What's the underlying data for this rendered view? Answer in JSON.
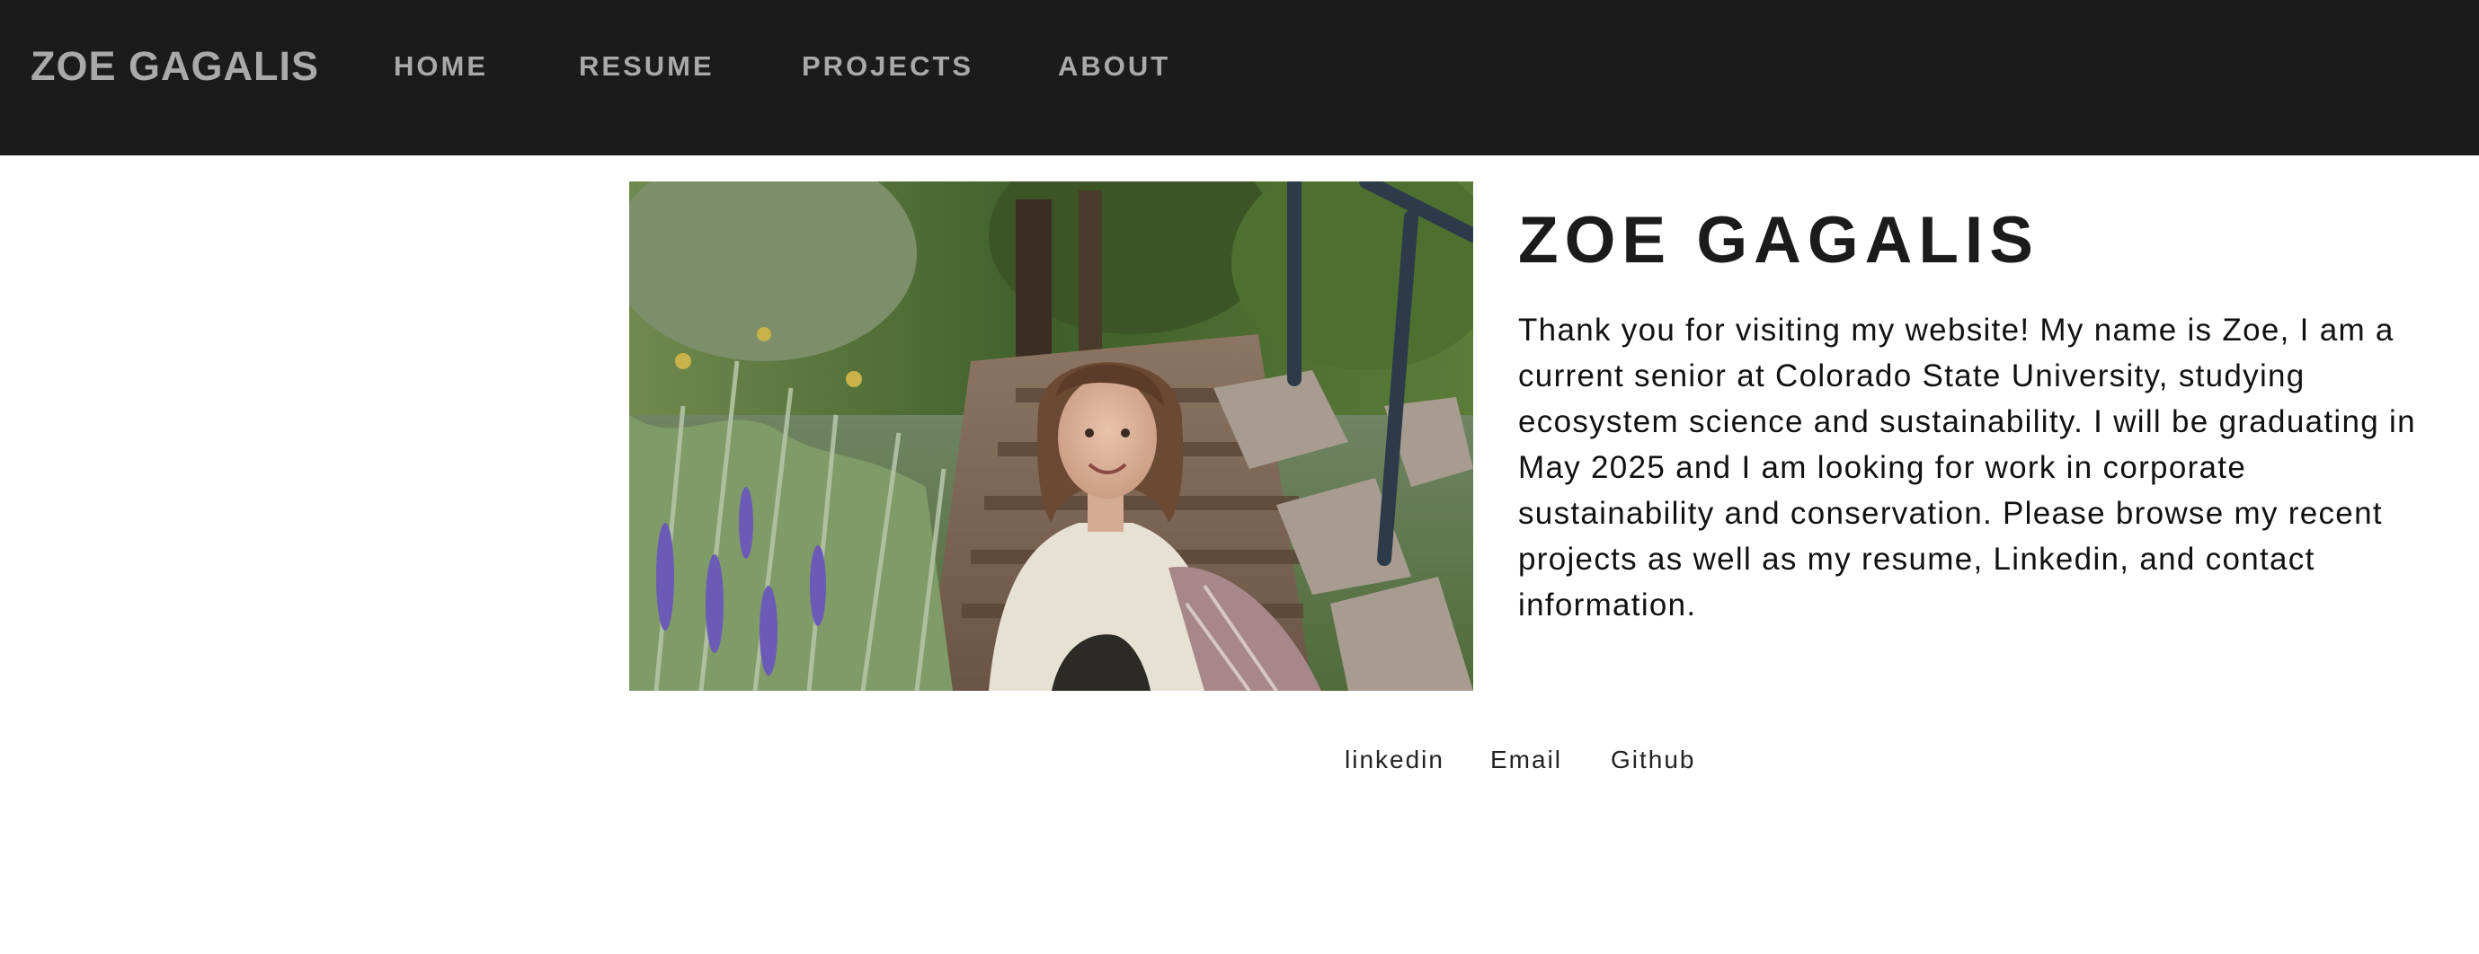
{
  "nav": {
    "brand": "ZOE GAGALIS",
    "links": [
      {
        "label": "HOME"
      },
      {
        "label": "RESUME"
      },
      {
        "label": "PROJECTS"
      },
      {
        "label": "ABOUT"
      }
    ],
    "background": "#1b1b1b",
    "link_color": "#a9a9a9"
  },
  "hero": {
    "title": "ZOE GAGALIS",
    "intro": "Thank you for visiting my website! My name is Zoe, I am a current senior at Colorado State University, studying ecosystem science and sustainability. I will be graduating in May 2025 and I am looking for work in corporate sustainability and conservation. Please browse my recent projects as well as my resume, Linkedin, and contact information.",
    "photo_icon": "portrait-photo"
  },
  "footer": {
    "links": [
      {
        "label": "linkedin"
      },
      {
        "label": "Email"
      },
      {
        "label": "Github"
      }
    ]
  }
}
